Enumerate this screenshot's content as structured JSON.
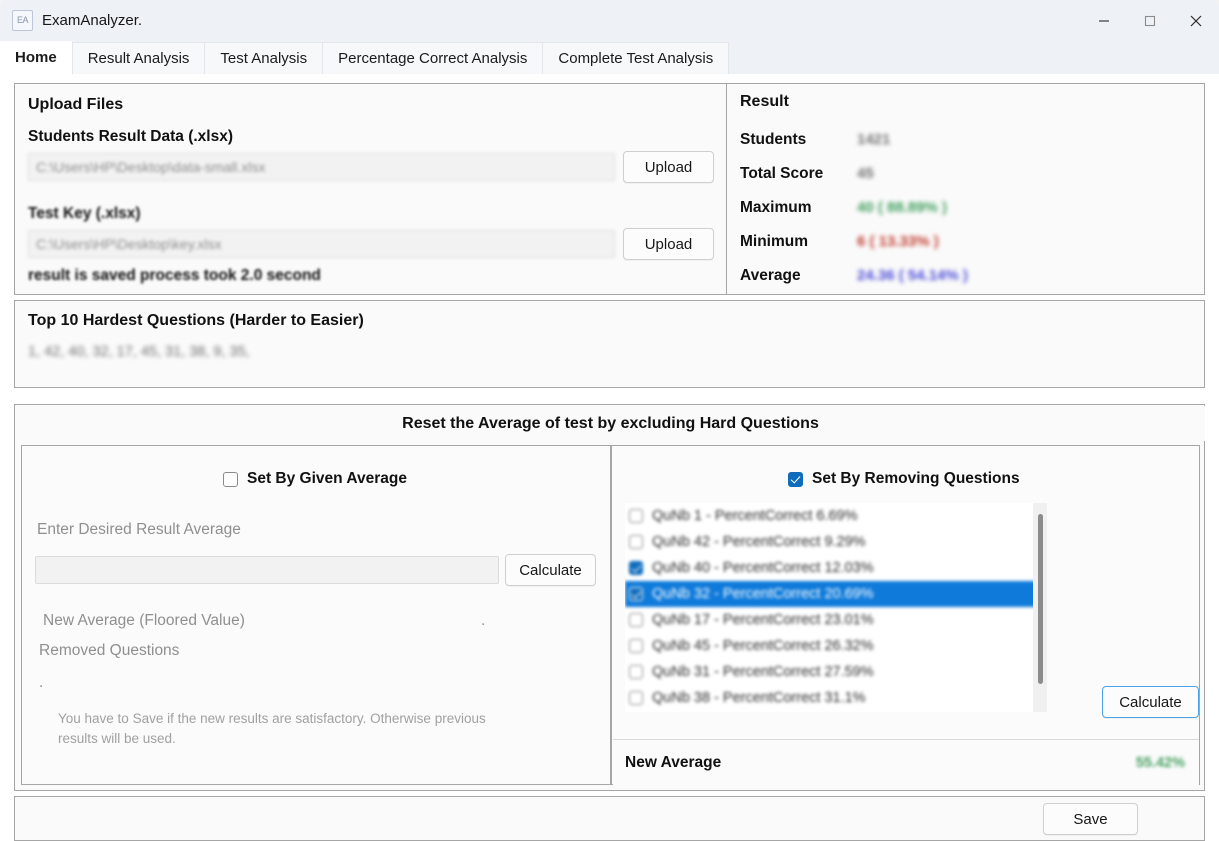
{
  "window": {
    "title": "ExamAnalyzer.",
    "icon_label": "EA",
    "controls": {
      "minimize": "minimize-icon",
      "maximize": "maximize-icon",
      "close": "close-icon"
    }
  },
  "tabs": [
    {
      "label": "Home",
      "active": true
    },
    {
      "label": "Result Analysis",
      "active": false
    },
    {
      "label": "Test Analysis",
      "active": false
    },
    {
      "label": "Percentage Correct Analysis",
      "active": false
    },
    {
      "label": "Complete Test Analysis",
      "active": false
    }
  ],
  "upload": {
    "group_title": "Upload Files",
    "students_label": "Students Result Data (.xlsx)",
    "students_path": "C:\\Users\\HP\\Desktop\\data-small.xlsx",
    "students_upload_button": "Upload",
    "key_label": "Test Key (.xlsx)",
    "key_path": "C:\\Users\\HP\\Desktop\\key.xlsx",
    "key_upload_button": "Upload",
    "status": "result is saved process took 2.0 second"
  },
  "result": {
    "group_title": "Result",
    "rows": [
      {
        "label": "Students",
        "value": "1421",
        "color": "#707070"
      },
      {
        "label": "Total Score",
        "value": "45",
        "color": "#707070"
      },
      {
        "label": "Maximum",
        "value": "40  ( 88.89% )",
        "color": "#3f9e5c"
      },
      {
        "label": "Minimum",
        "value": "6  ( 13.33% )",
        "color": "#c0392b"
      },
      {
        "label": "Average",
        "value": "24.36 ( 54.14% )",
        "color": "#4a4ad8"
      }
    ]
  },
  "hardest": {
    "title": "Top 10 Hardest Questions (Harder to Easier)",
    "questions": "1, 42, 40, 32, 17, 45, 31, 38, 9, 35,"
  },
  "reset": {
    "header": "Reset the Average of test by excluding Hard Questions",
    "left": {
      "checkbox_label": "Set By Given Average",
      "checkbox_checked": false,
      "input_label": "Enter Desired Result Average",
      "input_value": "",
      "calculate_button": "Calculate",
      "new_average_label": "New Average (Floored Value)",
      "new_average_value": ".",
      "removed_label": "Removed Questions",
      "removed_value": ".",
      "hint": "You have to Save if the new results are satisfactory. Otherwise previous results will be used."
    },
    "right": {
      "checkbox_label": "Set By Removing Questions",
      "checkbox_checked": true,
      "items": [
        {
          "label": "QuNb 1 - PercentCorrect 6.69%",
          "checked": false,
          "selected": false
        },
        {
          "label": "QuNb 42 - PercentCorrect 9.29%",
          "checked": false,
          "selected": false
        },
        {
          "label": "QuNb 40 - PercentCorrect 12.03%",
          "checked": true,
          "selected": false
        },
        {
          "label": "QuNb 32 - PercentCorrect 20.69%",
          "checked": true,
          "selected": true
        },
        {
          "label": "QuNb 17 - PercentCorrect 23.01%",
          "checked": false,
          "selected": false
        },
        {
          "label": "QuNb 45 - PercentCorrect 26.32%",
          "checked": false,
          "selected": false
        },
        {
          "label": "QuNb 31 - PercentCorrect 27.59%",
          "checked": false,
          "selected": false
        },
        {
          "label": "QuNb 38 - PercentCorrect 31.1%",
          "checked": false,
          "selected": false
        }
      ],
      "calculate_button": "Calculate",
      "new_average_label": "New Average",
      "new_average_value": "55.42%"
    }
  },
  "footer": {
    "save_button": "Save"
  },
  "colors": {
    "accent": "#0f6cbd",
    "selection": "#0f7ada",
    "positive": "#49a163",
    "negative": "#c0392b"
  }
}
